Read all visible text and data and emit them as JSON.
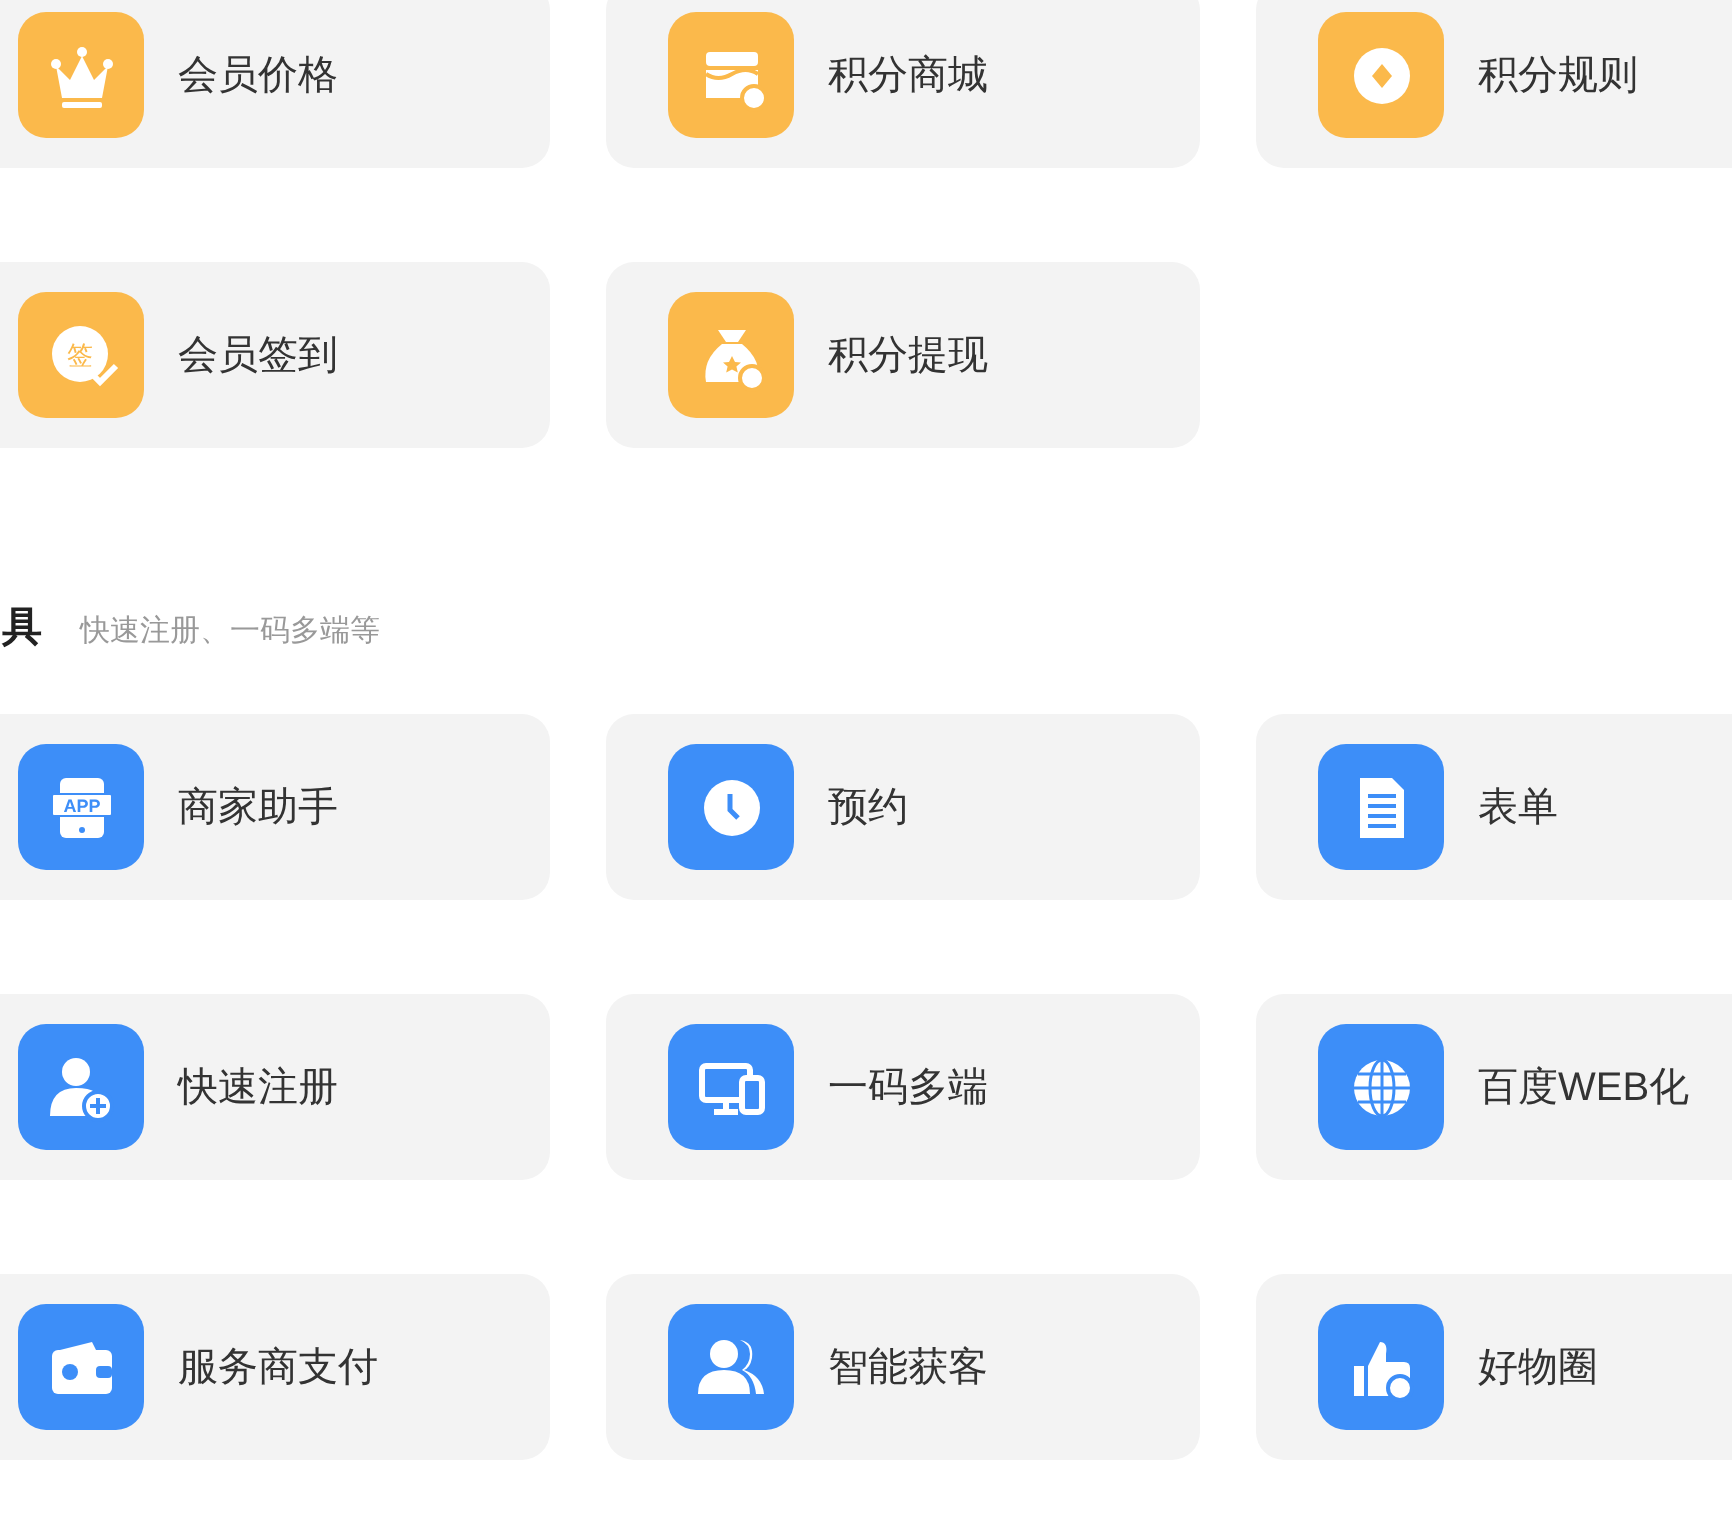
{
  "sections": [
    {
      "color": "#fbb94b",
      "items": [
        {
          "label": "会员价格"
        },
        {
          "label": "积分商城"
        },
        {
          "label": "积分规则"
        },
        {
          "label": "会员签到",
          "icon_text": "签"
        },
        {
          "label": "积分提现"
        }
      ]
    },
    {
      "color": "#3d8ef8",
      "title": "具",
      "subtitle": "快速注册、一码多端等",
      "items": [
        {
          "label": "商家助手",
          "icon_text": "APP"
        },
        {
          "label": "预约"
        },
        {
          "label": "表单"
        },
        {
          "label": "快速注册"
        },
        {
          "label": "一码多端"
        },
        {
          "label": "百度WEB化"
        },
        {
          "label": "服务商支付"
        },
        {
          "label": "智能获客"
        },
        {
          "label": "好物圈"
        }
      ]
    }
  ]
}
